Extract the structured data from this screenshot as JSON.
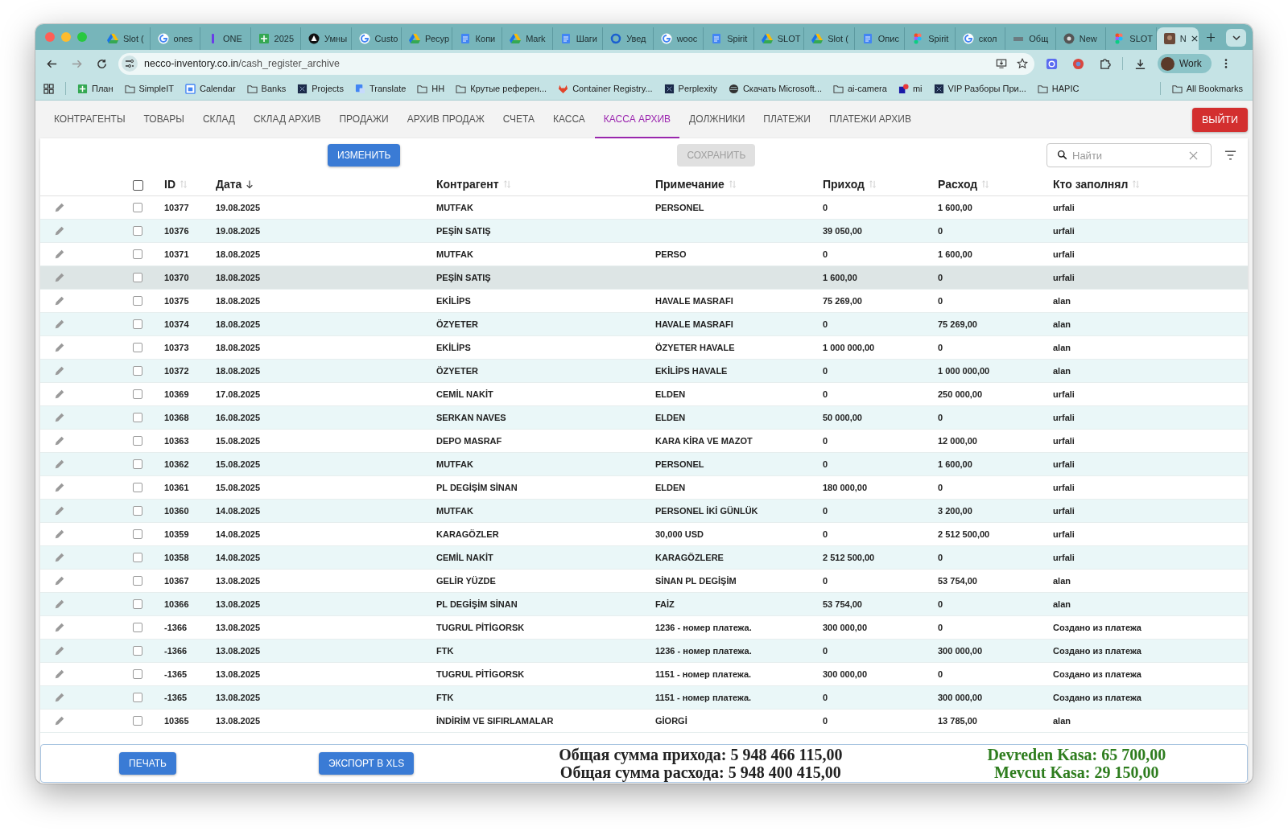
{
  "browser": {
    "tabs": [
      {
        "title": "Slot (",
        "selected": false
      },
      {
        "title": "ones",
        "selected": false
      },
      {
        "title": "ONE",
        "selected": false
      },
      {
        "title": "2025",
        "selected": false
      },
      {
        "title": "Умны",
        "selected": false
      },
      {
        "title": "Custo",
        "selected": false
      },
      {
        "title": "Ресур",
        "selected": false
      },
      {
        "title": "Копи",
        "selected": false
      },
      {
        "title": "Mark",
        "selected": false
      },
      {
        "title": "Шаги",
        "selected": false
      },
      {
        "title": "Увед",
        "selected": false
      },
      {
        "title": "wooc",
        "selected": false
      },
      {
        "title": "Spirit",
        "selected": false
      },
      {
        "title": "SLOT",
        "selected": false
      },
      {
        "title": "Slot (",
        "selected": false
      },
      {
        "title": "Опис",
        "selected": false
      },
      {
        "title": "Spirit",
        "selected": false
      },
      {
        "title": "скол",
        "selected": false
      },
      {
        "title": "Общ",
        "selected": false
      },
      {
        "title": "New",
        "selected": false
      },
      {
        "title": "SLOT",
        "selected": false
      },
      {
        "title": "N",
        "selected": true
      }
    ],
    "address": {
      "host": "necco-inventory.co.in",
      "path": "/cash_register_archive"
    },
    "profile": "Work",
    "bookmarks": [
      {
        "label": "План"
      },
      {
        "label": "SimpleIT"
      },
      {
        "label": "Calendar"
      },
      {
        "label": "Banks"
      },
      {
        "label": "Projects"
      },
      {
        "label": "Translate"
      },
      {
        "label": "HH"
      },
      {
        "label": "Крутые референ..."
      },
      {
        "label": "Container Registry..."
      },
      {
        "label": "Perplexity"
      },
      {
        "label": "Скачать Microsoft..."
      },
      {
        "label": "ai-camera"
      },
      {
        "label": "mi"
      },
      {
        "label": "VIP Разборы При..."
      },
      {
        "label": "HAPIC"
      }
    ],
    "all_bookmarks": "All Bookmarks"
  },
  "nav": {
    "tabs": [
      {
        "label": "КОНТРАГЕНТЫ",
        "selected": false
      },
      {
        "label": "ТОВАРЫ",
        "selected": false
      },
      {
        "label": "СКЛАД",
        "selected": false
      },
      {
        "label": "СКЛАД АРХИВ",
        "selected": false
      },
      {
        "label": "ПРОДАЖИ",
        "selected": false
      },
      {
        "label": "АРХИВ ПРОДАЖ",
        "selected": false
      },
      {
        "label": "СЧЕТА",
        "selected": false
      },
      {
        "label": "КАССА",
        "selected": false
      },
      {
        "label": "КАССА АРХИВ",
        "selected": true
      },
      {
        "label": "ДОЛЖНИКИ",
        "selected": false
      },
      {
        "label": "ПЛАТЕЖИ",
        "selected": false
      },
      {
        "label": "ПЛАТЕЖИ АРХИВ",
        "selected": false
      }
    ],
    "logout": "ВЫЙТИ"
  },
  "toolbar": {
    "edit_button": "ИЗМЕНИТЬ",
    "save_button": {
      "label": "СОХРАНИТЬ",
      "disabled": true
    },
    "search": {
      "placeholder": "Найти"
    }
  },
  "table": {
    "select_all_checked": false,
    "columns": [
      {
        "label": "ID",
        "sorted": false
      },
      {
        "label": "Дата",
        "sorted": true
      },
      {
        "label": "Контрагент",
        "sorted": false
      },
      {
        "label": "Примечание",
        "sorted": false
      },
      {
        "label": "Приход",
        "sorted": false
      },
      {
        "label": "Расход",
        "sorted": false
      },
      {
        "label": "Кто заполнял",
        "sorted": false
      }
    ],
    "rows": [
      {
        "id": "10377",
        "date": "19.08.2025",
        "counterparty": "MUTFAK",
        "note": "PERSONEL",
        "income": "0",
        "expense": "1 600,00",
        "filled_by": "urfali",
        "checked": false,
        "highlighted": false
      },
      {
        "id": "10376",
        "date": "19.08.2025",
        "counterparty": "PEŞİN SATIŞ",
        "note": "",
        "income": "39 050,00",
        "expense": "0",
        "filled_by": "urfali",
        "checked": false,
        "highlighted": false
      },
      {
        "id": "10371",
        "date": "18.08.2025",
        "counterparty": "MUTFAK",
        "note": "PERSO",
        "income": "0",
        "expense": "1 600,00",
        "filled_by": "urfali",
        "checked": false,
        "highlighted": false
      },
      {
        "id": "10370",
        "date": "18.08.2025",
        "counterparty": "PEŞİN SATIŞ",
        "note": "",
        "income": "1 600,00",
        "expense": "0",
        "filled_by": "urfali",
        "checked": false,
        "highlighted": true
      },
      {
        "id": "10375",
        "date": "18.08.2025",
        "counterparty": "EKİLİPS",
        "note": "HAVALE MASRAFI",
        "income": "75 269,00",
        "expense": "0",
        "filled_by": "alan",
        "checked": false,
        "highlighted": false
      },
      {
        "id": "10374",
        "date": "18.08.2025",
        "counterparty": "ÖZYETER",
        "note": "HAVALE MASRAFI",
        "income": "0",
        "expense": "75 269,00",
        "filled_by": "alan",
        "checked": false,
        "highlighted": false
      },
      {
        "id": "10373",
        "date": "18.08.2025",
        "counterparty": "EKİLİPS",
        "note": "ÖZYETER HAVALE",
        "income": "1 000 000,00",
        "expense": "0",
        "filled_by": "alan",
        "checked": false,
        "highlighted": false
      },
      {
        "id": "10372",
        "date": "18.08.2025",
        "counterparty": "ÖZYETER",
        "note": "EKİLİPS HAVALE",
        "income": "0",
        "expense": "1 000 000,00",
        "filled_by": "alan",
        "checked": false,
        "highlighted": false
      },
      {
        "id": "10369",
        "date": "17.08.2025",
        "counterparty": "CEMİL NAKİT",
        "note": "ELDEN",
        "income": "0",
        "expense": "250 000,00",
        "filled_by": "urfali",
        "checked": false,
        "highlighted": false
      },
      {
        "id": "10368",
        "date": "16.08.2025",
        "counterparty": "SERKAN NAVES",
        "note": "ELDEN",
        "income": "50 000,00",
        "expense": "0",
        "filled_by": "urfali",
        "checked": false,
        "highlighted": false
      },
      {
        "id": "10363",
        "date": "15.08.2025",
        "counterparty": "DEPO MASRAF",
        "note": "KARA KİRA VE MAZOT",
        "income": "0",
        "expense": "12 000,00",
        "filled_by": "urfali",
        "checked": false,
        "highlighted": false
      },
      {
        "id": "10362",
        "date": "15.08.2025",
        "counterparty": "MUTFAK",
        "note": "PERSONEL",
        "income": "0",
        "expense": "1 600,00",
        "filled_by": "urfali",
        "checked": false,
        "highlighted": false
      },
      {
        "id": "10361",
        "date": "15.08.2025",
        "counterparty": "PL DEGİŞİM SİNAN",
        "note": "ELDEN",
        "income": "180 000,00",
        "expense": "0",
        "filled_by": "urfali",
        "checked": false,
        "highlighted": false
      },
      {
        "id": "10360",
        "date": "14.08.2025",
        "counterparty": "MUTFAK",
        "note": "PERSONEL İKİ GÜNLÜK",
        "income": "0",
        "expense": "3 200,00",
        "filled_by": "urfali",
        "checked": false,
        "highlighted": false
      },
      {
        "id": "10359",
        "date": "14.08.2025",
        "counterparty": "KARAGÖZLER",
        "note": "30,000 USD",
        "income": "0",
        "expense": "2 512 500,00",
        "filled_by": "urfali",
        "checked": false,
        "highlighted": false
      },
      {
        "id": "10358",
        "date": "14.08.2025",
        "counterparty": "CEMİL NAKİT",
        "note": "KARAGÖZLERE",
        "income": "2 512 500,00",
        "expense": "0",
        "filled_by": "urfali",
        "checked": false,
        "highlighted": false
      },
      {
        "id": "10367",
        "date": "13.08.2025",
        "counterparty": "GELİR YÜZDE",
        "note": "SİNAN PL DEGİŞİM",
        "income": "0",
        "expense": "53 754,00",
        "filled_by": "alan",
        "checked": false,
        "highlighted": false
      },
      {
        "id": "10366",
        "date": "13.08.2025",
        "counterparty": "PL DEGİŞİM SİNAN",
        "note": "FAİZ",
        "income": "53 754,00",
        "expense": "0",
        "filled_by": "alan",
        "checked": false,
        "highlighted": false
      },
      {
        "id": "-1366",
        "date": "13.08.2025",
        "counterparty": "TUGRUL PİTİGORSK",
        "note": "1236 - номер платежа.",
        "income": "300 000,00",
        "expense": "0",
        "filled_by": "Создано из платежа",
        "checked": false,
        "highlighted": false
      },
      {
        "id": "-1366",
        "date": "13.08.2025",
        "counterparty": "FTK",
        "note": "1236 - номер платежа.",
        "income": "0",
        "expense": "300 000,00",
        "filled_by": "Создано из платежа",
        "checked": false,
        "highlighted": false
      },
      {
        "id": "-1365",
        "date": "13.08.2025",
        "counterparty": "TUGRUL PİTİGORSK",
        "note": "1151 - номер платежа.",
        "income": "300 000,00",
        "expense": "0",
        "filled_by": "Создано из платежа",
        "checked": false,
        "highlighted": false
      },
      {
        "id": "-1365",
        "date": "13.08.2025",
        "counterparty": "FTK",
        "note": "1151 - номер платежа.",
        "income": "0",
        "expense": "300 000,00",
        "filled_by": "Создано из платежа",
        "checked": false,
        "highlighted": false
      },
      {
        "id": "10365",
        "date": "13.08.2025",
        "counterparty": "İNDİRİM VE SIFIRLAMALAR",
        "note": "GİORGİ",
        "income": "0",
        "expense": "13 785,00",
        "filled_by": "alan",
        "checked": false,
        "highlighted": false
      }
    ]
  },
  "footer": {
    "print_button": "ПЕЧАТЬ",
    "export_button": "ЭКСПОРТ В XLS",
    "totals": [
      "Общая сумма прихода: 5 948 466 115,00",
      "Общая сумма расхода: 5 948 400 415,00"
    ],
    "kasa": [
      "Devreden Kasa: 65 700,00",
      "Mevcut Kasa: 29 150,00"
    ]
  }
}
